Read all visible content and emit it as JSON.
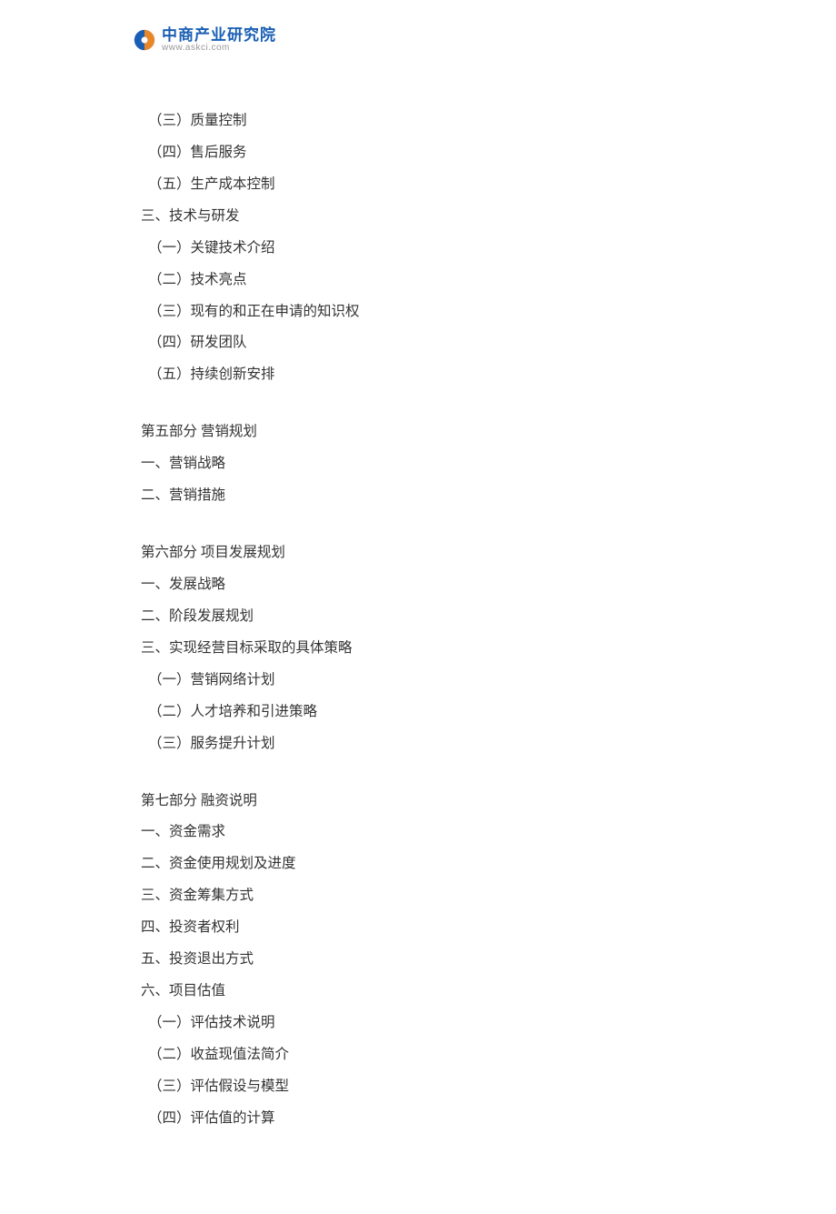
{
  "logo": {
    "title": "中商产业研究院",
    "subtitle": "www.askci.com"
  },
  "outline": [
    {
      "text": "（三）质量控制",
      "indent": true,
      "gap": false
    },
    {
      "text": "（四）售后服务",
      "indent": true,
      "gap": false
    },
    {
      "text": "（五）生产成本控制",
      "indent": true,
      "gap": false
    },
    {
      "text": "三、技术与研发",
      "indent": false,
      "gap": false
    },
    {
      "text": "（一）关键技术介绍",
      "indent": true,
      "gap": false
    },
    {
      "text": "（二）技术亮点",
      "indent": true,
      "gap": false
    },
    {
      "text": "（三）现有的和正在申请的知识权",
      "indent": true,
      "gap": false
    },
    {
      "text": "（四）研发团队",
      "indent": true,
      "gap": false
    },
    {
      "text": "（五）持续创新安排",
      "indent": true,
      "gap": false
    },
    {
      "text": "第五部分  营销规划",
      "indent": false,
      "gap": true
    },
    {
      "text": "一、营销战略",
      "indent": false,
      "gap": false
    },
    {
      "text": "二、营销措施",
      "indent": false,
      "gap": false
    },
    {
      "text": "第六部分  项目发展规划",
      "indent": false,
      "gap": true
    },
    {
      "text": "一、发展战略",
      "indent": false,
      "gap": false
    },
    {
      "text": "二、阶段发展规划",
      "indent": false,
      "gap": false
    },
    {
      "text": "三、实现经营目标采取的具体策略",
      "indent": false,
      "gap": false
    },
    {
      "text": "（一）营销网络计划",
      "indent": true,
      "gap": false
    },
    {
      "text": "（二）人才培养和引进策略",
      "indent": true,
      "gap": false
    },
    {
      "text": "（三）服务提升计划",
      "indent": true,
      "gap": false
    },
    {
      "text": "第七部分  融资说明",
      "indent": false,
      "gap": true
    },
    {
      "text": "一、资金需求",
      "indent": false,
      "gap": false
    },
    {
      "text": "二、资金使用规划及进度",
      "indent": false,
      "gap": false
    },
    {
      "text": "三、资金筹集方式",
      "indent": false,
      "gap": false
    },
    {
      "text": "四、投资者权利",
      "indent": false,
      "gap": false
    },
    {
      "text": "五、投资退出方式",
      "indent": false,
      "gap": false
    },
    {
      "text": "六、项目估值",
      "indent": false,
      "gap": false
    },
    {
      "text": "（一）评估技术说明",
      "indent": true,
      "gap": false
    },
    {
      "text": "（二）收益现值法简介",
      "indent": true,
      "gap": false
    },
    {
      "text": "（三）评估假设与模型",
      "indent": true,
      "gap": false
    },
    {
      "text": "（四）评估值的计算",
      "indent": true,
      "gap": false
    }
  ]
}
